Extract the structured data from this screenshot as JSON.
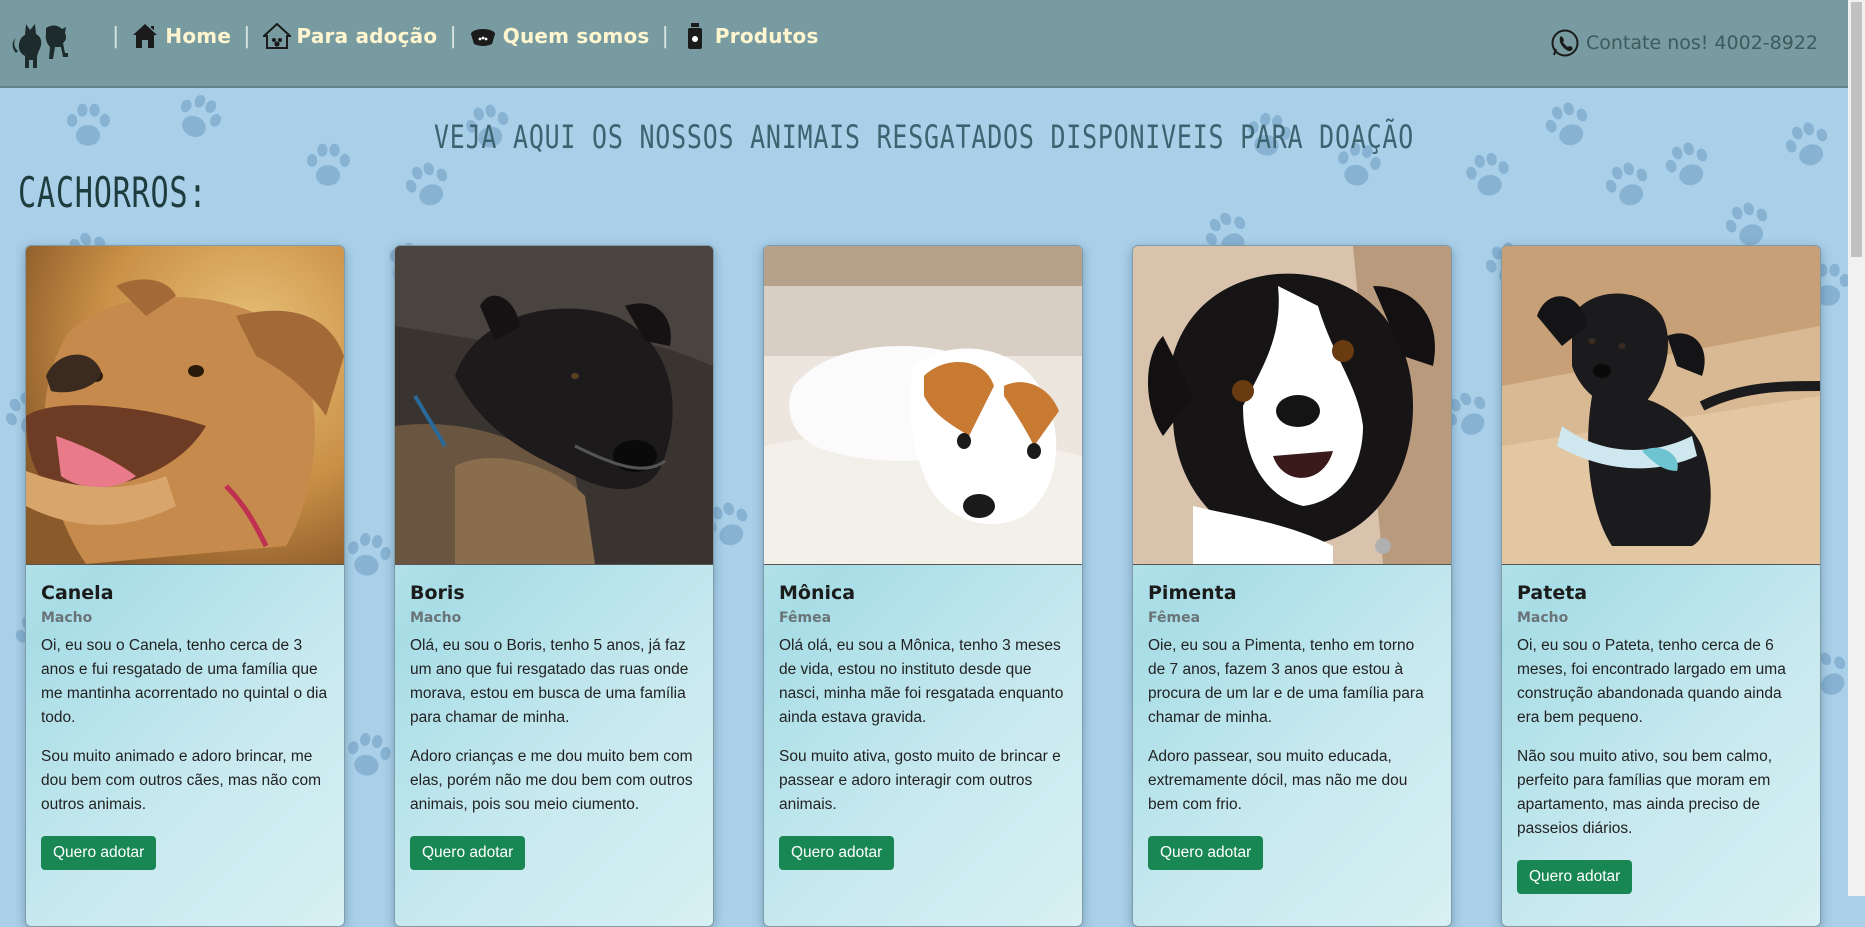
{
  "nav": {
    "items": [
      {
        "label": "Home",
        "icon": "house-icon"
      },
      {
        "label": "Para adoção",
        "icon": "pet-house-icon"
      },
      {
        "label": "Quem somos",
        "icon": "pet-bowl-icon"
      },
      {
        "label": "Produtos",
        "icon": "pet-food-bottle-icon"
      }
    ],
    "separator": "|",
    "contact": "Contate nos! 4002-8922",
    "contact_icon": "whatsapp-phone-icon",
    "logo_icon": "cat-dog-logo-icon"
  },
  "page": {
    "heading": "VEJA AQUI OS NOSSOS ANIMAIS RESGATADOS DISPONIVEIS PARA DOAÇÃO",
    "section": "CACHORROS:"
  },
  "colors": {
    "navbar": "#779ba0",
    "nav_text": "#fff6cf",
    "background": "#a9cfe9",
    "button": "#198754"
  },
  "cards": [
    {
      "name": "Canela",
      "sex": "Macho",
      "p1": "Oi, eu sou o Canela, tenho cerca de 3 anos e fui resgatado de uma família que me mantinha acorrentado no quintal o dia todo.",
      "p2": "Sou muito animado e adoro brincar, me dou bem com outros cães, mas não com outros animais.",
      "button": "Quero adotar"
    },
    {
      "name": "Boris",
      "sex": "Macho",
      "p1": "Olá, eu sou o Boris, tenho 5 anos, já faz um ano que fui resgatado das ruas onde morava, estou em busca de uma família para chamar de minha.",
      "p2": "Adoro crianças e me dou muito bem com elas, porém não me dou bem com outros animais, pois sou meio ciumento.",
      "button": "Quero adotar"
    },
    {
      "name": "Mônica",
      "sex": "Fêmea",
      "p1": "Olá olá, eu sou a Mônica, tenho 3 meses de vida, estou no instituto desde que nasci, minha mãe foi resgatada enquanto ainda estava gravida.",
      "p2": "Sou muito ativa, gosto muito de brincar e passear e adoro interagir com outros animais.",
      "button": "Quero adotar"
    },
    {
      "name": "Pimenta",
      "sex": "Fêmea",
      "p1": "Oie, eu sou a Pimenta, tenho em torno de 7 anos, fazem 3 anos que estou à procura de um lar e de uma família para chamar de minha.",
      "p2": "Adoro passear, sou muito educada, extremamente dócil, mas não me dou bem com frio.",
      "button": "Quero adotar"
    },
    {
      "name": "Pateta",
      "sex": "Macho",
      "p1": "Oi, eu sou o Pateta, tenho cerca de 6 meses, foi encontrado largado em uma construção abandonada quando ainda era bem pequeno.",
      "p2": "Não sou muito ativo, sou bem calmo, perfeito para famílias que moram em apartamento, mas ainda preciso de passeios diários.",
      "button": "Quero adotar"
    }
  ]
}
